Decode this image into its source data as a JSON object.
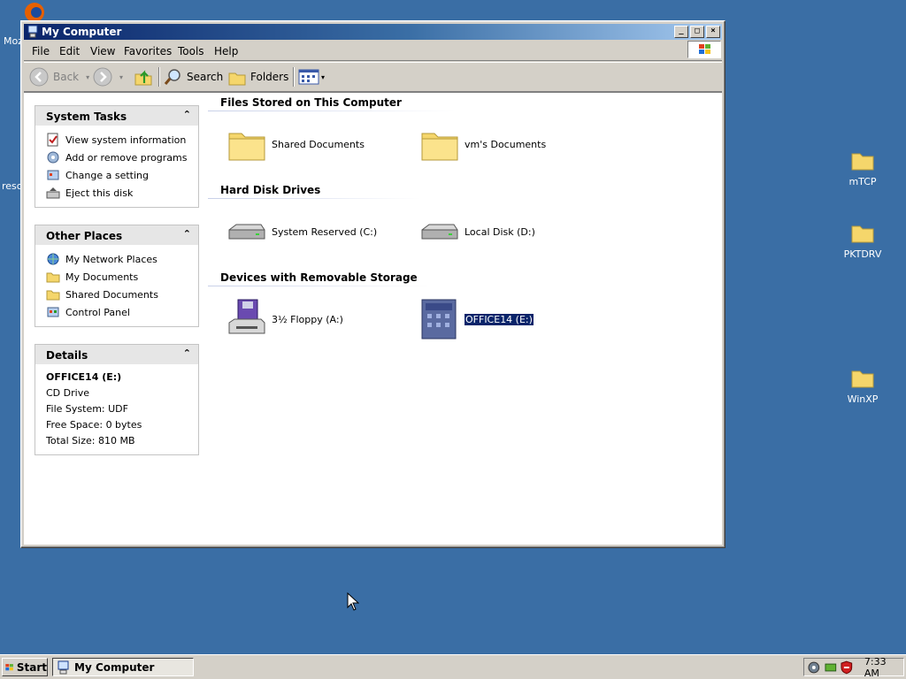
{
  "desktop": {
    "icons": [
      {
        "label": "mTCP"
      },
      {
        "label": "PKTDRV"
      },
      {
        "label": "WinXP"
      }
    ],
    "partial_left_labels": [
      "Moz",
      "resc"
    ]
  },
  "window": {
    "title": "My Computer",
    "buttons": {
      "minimize": "_",
      "maximize": "□",
      "close": "×"
    }
  },
  "menubar": {
    "items": [
      "File",
      "Edit",
      "View",
      "Favorites",
      "Tools",
      "Help"
    ]
  },
  "toolbar": {
    "back": "Back",
    "search": "Search",
    "folders": "Folders"
  },
  "panels": {
    "system_tasks": {
      "title": "System Tasks",
      "items": [
        "View system information",
        "Add or remove programs",
        "Change a setting",
        "Eject this disk"
      ]
    },
    "other_places": {
      "title": "Other Places",
      "items": [
        "My Network Places",
        "My Documents",
        "Shared Documents",
        "Control Panel"
      ]
    },
    "details": {
      "title": "Details",
      "name": "OFFICE14 (E:)",
      "type": "CD Drive",
      "file_system": "File System: UDF",
      "free_space": "Free Space: 0 bytes",
      "total_size": "Total Size: 810 MB"
    }
  },
  "sections": {
    "files": {
      "title": "Files Stored on This Computer",
      "items": [
        "Shared Documents",
        "vm's Documents"
      ]
    },
    "hdd": {
      "title": "Hard Disk Drives",
      "items": [
        "System Reserved (C:)",
        "Local Disk (D:)"
      ]
    },
    "removable": {
      "title": "Devices with Removable Storage",
      "items": [
        "3½ Floppy (A:)",
        "OFFICE14 (E:)"
      ]
    }
  },
  "taskbar": {
    "start": "Start",
    "task_button": "My Computer",
    "clock": "7:33 AM"
  },
  "colors": {
    "desktop": "#3a6ea5",
    "titlebar": "#0a246a",
    "selection": "#0a246a"
  }
}
